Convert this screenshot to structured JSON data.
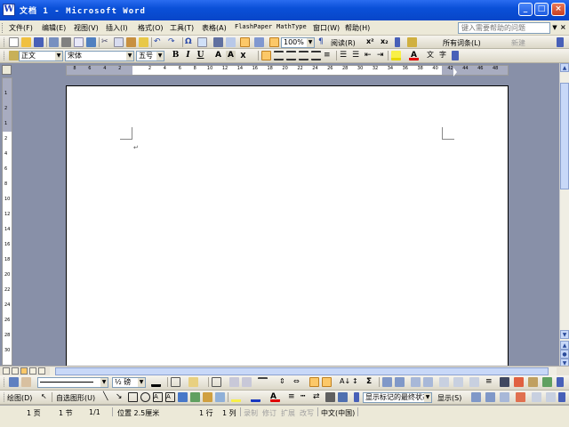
{
  "window": {
    "title": "文档 1 - Microsoft Word",
    "icon_letter": "W",
    "minimize_glyph": "_",
    "maximize_glyph": "□",
    "close_glyph": "×"
  },
  "menu": {
    "items": [
      "文件(F)",
      "编辑(E)",
      "视图(V)",
      "插入(I)",
      "格式(O)",
      "工具(T)",
      "表格(A)",
      "FlashPaper",
      "MathType",
      "窗口(W)",
      "帮助(H)"
    ],
    "help_placeholder": "键入需要帮助的问题",
    "close_doc": "×"
  },
  "standard_toolbar": {
    "zoom": "100%",
    "read_label": "阅读(R)",
    "all_terms": "所有词条(L)",
    "new_label": "新建"
  },
  "format_toolbar": {
    "style": "正文",
    "font": "宋体",
    "size": "五号",
    "bold": "B",
    "italic": "I",
    "underline": "U",
    "font_color_letter": "A"
  },
  "ruler": {
    "ticks": [
      "8",
      "6",
      "4",
      "2",
      "",
      "2",
      "4",
      "6",
      "8",
      "10",
      "12",
      "14",
      "16",
      "18",
      "20",
      "22",
      "24",
      "26",
      "28",
      "30",
      "32",
      "34",
      "36",
      "38",
      "40",
      "42",
      "44",
      "46",
      "48"
    ],
    "vticks": [
      "1",
      "2",
      "1",
      "2",
      "4",
      "6",
      "8",
      "10",
      "12",
      "14",
      "16",
      "18",
      "20",
      "22",
      "24",
      "26",
      "28",
      "30"
    ]
  },
  "document": {
    "paragraph_mark": "↵"
  },
  "drawing_toolbar": {
    "line_style": "½ 磅",
    "draw_label": "绘图(D)",
    "autoshape_label": "自选图形(U)",
    "markup_state": "显示标记的最终状态",
    "show_label": "显示(S)"
  },
  "status": {
    "page": "1 页",
    "section": "1 节",
    "pages": "1/1",
    "position": "位置 2.5厘米",
    "line": "1 行",
    "column": "1 列",
    "rec": "录制",
    "trk": "修订",
    "ext": "扩展",
    "ovr": "改写",
    "language": "中文(中国)"
  },
  "colors": {
    "titlebar": "#0a50d8",
    "workspace": "#8890a8",
    "toolbar": "#ece9d8"
  }
}
